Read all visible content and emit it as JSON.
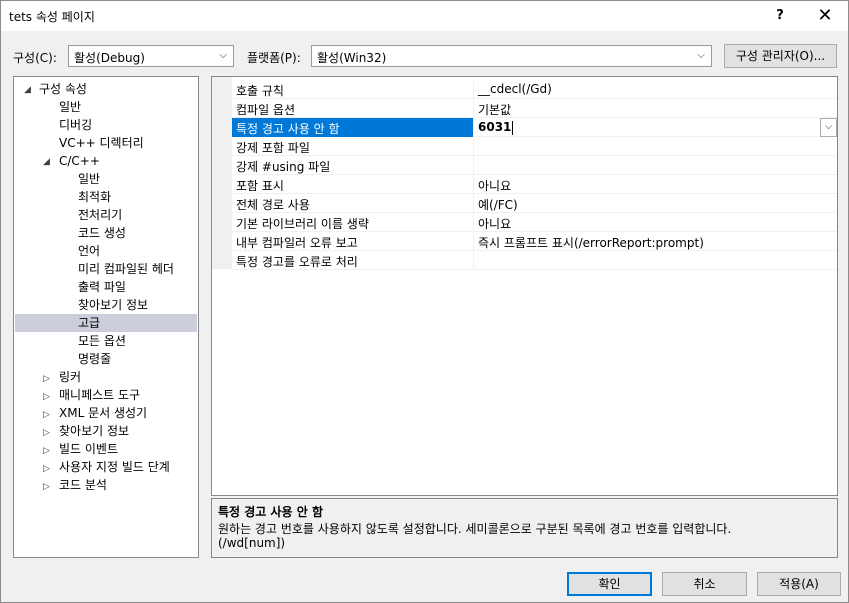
{
  "window": {
    "title": "tets 속성 페이지",
    "help_label": "?",
    "close_label": "✕"
  },
  "toolbar": {
    "config_label": "구성(C):",
    "config_value": "활성(Debug)",
    "platform_label": "플랫폼(P):",
    "platform_value": "활성(Win32)",
    "manager_label": "구성 관리자(O)..."
  },
  "tree": {
    "root": "구성 속성",
    "items": [
      "일반",
      "디버깅",
      "VC++ 디렉터리"
    ],
    "cpp": "C/C++",
    "cpp_items": [
      "일반",
      "최적화",
      "전처리기",
      "코드 생성",
      "언어",
      "미리 컴파일된 헤더",
      "출력 파일",
      "찾아보기 정보",
      "고급",
      "모든 옵션",
      "명령줄"
    ],
    "collapsed": [
      "링커",
      "매니페스트 도구",
      "XML 문서 생성기",
      "찾아보기 정보",
      "빌드 이벤트",
      "사용자 지정 빌드 단계",
      "코드 분석"
    ]
  },
  "grid": {
    "rows": [
      {
        "name": "호출 규칙",
        "value": "__cdecl(/Gd)"
      },
      {
        "name": "컴파일 옵션",
        "value": "기본값"
      },
      {
        "name": "특정 경고 사용 안 함",
        "value": "6031"
      },
      {
        "name": "강제 포함 파일",
        "value": ""
      },
      {
        "name": "강제 #using 파일",
        "value": ""
      },
      {
        "name": "포함 표시",
        "value": "아니요"
      },
      {
        "name": "전체 경로 사용",
        "value": "예(/FC)"
      },
      {
        "name": "기본 라이브러리 이름 생략",
        "value": "아니요"
      },
      {
        "name": "내부 컴파일러 오류 보고",
        "value": "즉시 프롬프트 표시(/errorReport:prompt)"
      },
      {
        "name": "특정 경고를 오류로 처리",
        "value": ""
      }
    ]
  },
  "description": {
    "title": "특정 경고 사용 안 함",
    "text": "원하는 경고 번호를 사용하지 않도록 설정합니다. 세미콜론으로 구분된 목록에 경고 번호를 입력합니다.",
    "switch": "(/wd[num])"
  },
  "buttons": {
    "ok": "확인",
    "cancel": "취소",
    "apply": "적용(A)"
  },
  "colors": {
    "accent": "#0078d7",
    "tree_selection": "#cccedb",
    "background": "#f0f0f0"
  }
}
